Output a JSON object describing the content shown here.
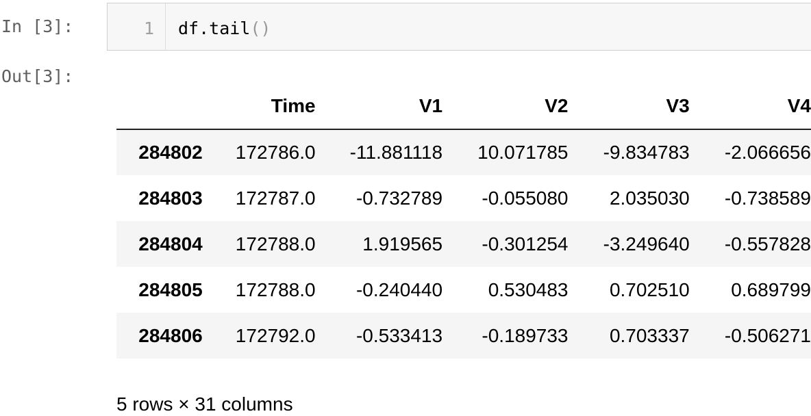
{
  "cell": {
    "in_prompt": "In [3]:",
    "out_prompt": "Out[3]:",
    "line_number": "1",
    "code_name": "df.tail",
    "code_parens": "()"
  },
  "table": {
    "columns": [
      "",
      "Time",
      "V1",
      "V2",
      "V3",
      "V4"
    ],
    "rows": [
      {
        "index": "284802",
        "cells": [
          "172786.0",
          "-11.881118",
          "10.071785",
          "-9.834783",
          "-2.066656"
        ]
      },
      {
        "index": "284803",
        "cells": [
          "172787.0",
          "-0.732789",
          "-0.055080",
          "2.035030",
          "-0.738589"
        ]
      },
      {
        "index": "284804",
        "cells": [
          "172788.0",
          "1.919565",
          "-0.301254",
          "-3.249640",
          "-0.557828"
        ]
      },
      {
        "index": "284805",
        "cells": [
          "172788.0",
          "-0.240440",
          "0.530483",
          "0.702510",
          "0.689799"
        ]
      },
      {
        "index": "284806",
        "cells": [
          "172792.0",
          "-0.533413",
          "-0.189733",
          "0.703337",
          "-0.506271"
        ]
      }
    ]
  },
  "shape_note": "5 rows × 31 columns",
  "colors": {
    "prompt": "#5f5f5f",
    "input_background": "#f7f7f7",
    "input_border": "#cfcfcf",
    "striped_row": "#f5f5f5",
    "header_rule": "#222222"
  }
}
